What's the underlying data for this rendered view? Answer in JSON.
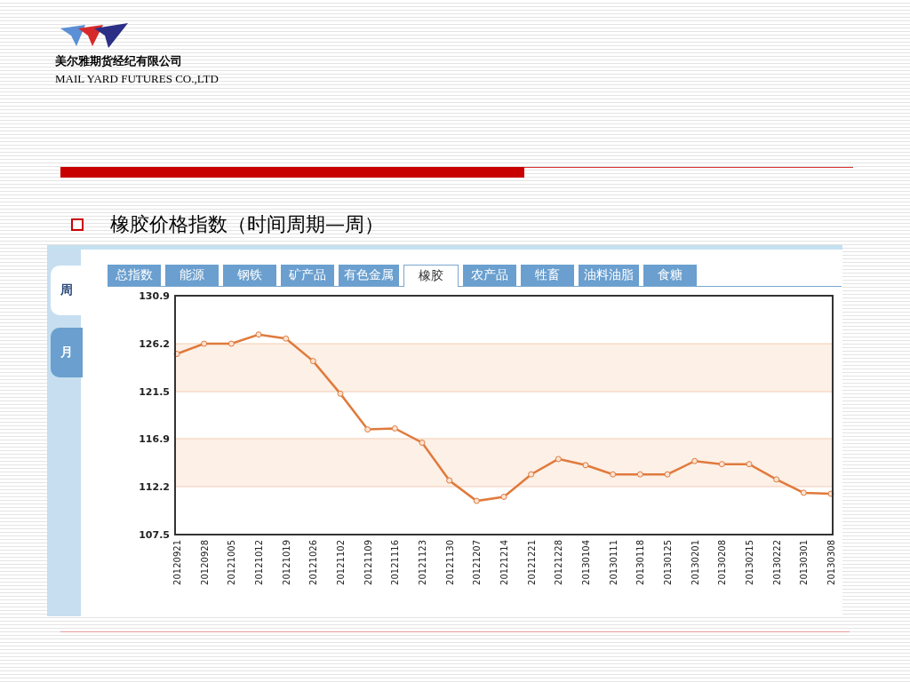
{
  "header": {
    "company_cn": "美尔雅期货经纪有限公司",
    "company_en": "MAIL YARD FUTURES CO.,LTD"
  },
  "slide_title": "橡胶价格指数（时间周期—周）",
  "panel": {
    "period_tabs": [
      {
        "label": "周",
        "selected": true
      },
      {
        "label": "月",
        "selected": false
      }
    ],
    "category_tabs": [
      {
        "label": "总指数",
        "selected": false
      },
      {
        "label": "能源",
        "selected": false
      },
      {
        "label": "钢铁",
        "selected": false
      },
      {
        "label": "矿产品",
        "selected": false
      },
      {
        "label": "有色金属",
        "selected": false
      },
      {
        "label": "橡胶",
        "selected": true
      },
      {
        "label": "农产品",
        "selected": false
      },
      {
        "label": "牲畜",
        "selected": false
      },
      {
        "label": "油料油脂",
        "selected": false
      },
      {
        "label": "食糖",
        "selected": false
      }
    ],
    "chart_data": {
      "type": "line",
      "categories": [
        "20120921",
        "20120928",
        "20121005",
        "20121012",
        "20121019",
        "20121026",
        "20121102",
        "20121109",
        "20121116",
        "20121123",
        "20121130",
        "20121207",
        "20121214",
        "20121221",
        "20121228",
        "20130104",
        "20130111",
        "20130118",
        "20130125",
        "20130201",
        "20130208",
        "20130215",
        "20130222",
        "20130301",
        "20130308"
      ],
      "grid": true,
      "series": [
        {
          "color": "#e07a3c",
          "marker": true,
          "values": [
            125.2,
            126.2,
            126.2,
            127.1,
            126.7,
            124.5,
            121.3,
            117.8,
            117.9,
            116.5,
            112.8,
            110.8,
            111.2,
            113.4,
            114.9,
            114.3,
            113.4,
            113.4,
            113.4,
            114.7,
            114.4,
            114.4,
            112.9,
            111.6,
            111.5
          ]
        }
      ],
      "ylim": [
        107.5,
        130.9
      ],
      "yticks": [
        107.5,
        112.2,
        116.9,
        121.5,
        126.2,
        130.9
      ]
    }
  }
}
